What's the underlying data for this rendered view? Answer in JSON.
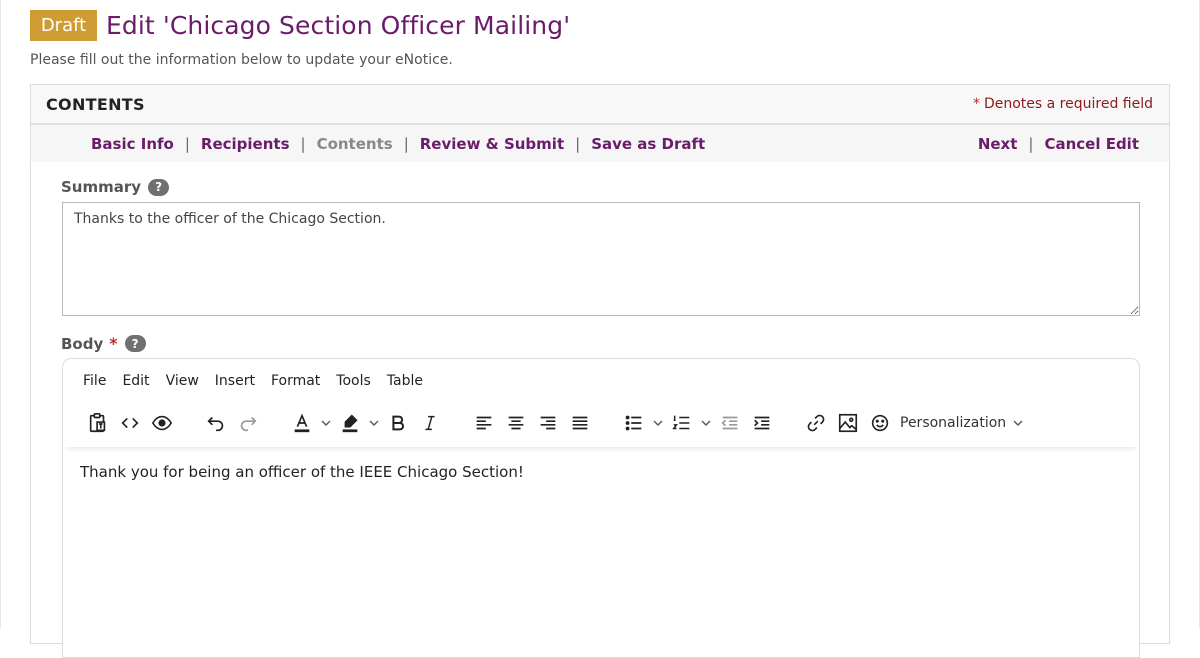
{
  "header": {
    "badge": "Draft",
    "title": "Edit 'Chicago Section Officer Mailing'",
    "subtitle": "Please fill out the information below to update your eNotice."
  },
  "panel": {
    "title": "CONTENTS",
    "required_note": "Denotes a required field",
    "required_marker": "*"
  },
  "nav": {
    "left": [
      {
        "label": "Basic Info",
        "current": false
      },
      {
        "label": "Recipients",
        "current": false
      },
      {
        "label": "Contents",
        "current": true
      },
      {
        "label": "Review & Submit",
        "current": false
      },
      {
        "label": "Save as Draft",
        "current": false
      }
    ],
    "right": [
      {
        "label": "Next"
      },
      {
        "label": "Cancel Edit"
      }
    ],
    "separator": "|"
  },
  "summary": {
    "label": "Summary",
    "help": "?",
    "value": "Thanks to the officer of the Chicago Section."
  },
  "body": {
    "label": "Body",
    "required_marker": "*",
    "help": "?",
    "menu": [
      "File",
      "Edit",
      "View",
      "Insert",
      "Format",
      "Tools",
      "Table"
    ],
    "toolbar_icons": [
      "paste-text-icon",
      "source-code-icon",
      "preview-eye-icon",
      "undo-icon",
      "redo-icon",
      "text-color-icon",
      "highlight-color-icon",
      "bold-icon",
      "italic-icon",
      "align-left-icon",
      "align-center-icon",
      "align-right-icon",
      "justify-icon",
      "bullet-list-icon",
      "numbered-list-icon",
      "outdent-icon",
      "indent-icon",
      "link-icon",
      "image-icon",
      "emoji-icon"
    ],
    "personalization_label": "Personalization",
    "content": "Thank you for being an officer of the IEEE Chicago Section!"
  },
  "colors": {
    "brand_purple": "#6a1b6a",
    "badge_gold": "#cf9c33",
    "required_red": "#c0282a"
  }
}
